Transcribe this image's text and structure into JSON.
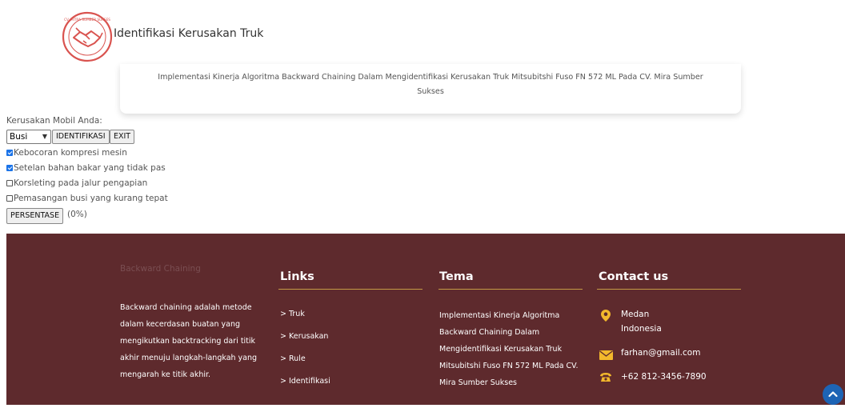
{
  "header": {
    "logo_icon": "handshake-logo-icon",
    "logo_ring_text": "CV. MITRA SUMBER SUKSES",
    "brand_title": "Identifikasi Kerusakan Truk",
    "banner_text": "Implementasi Kinerja Algoritma Backward Chaining Dalam Mengidentifikasi Kerusakan Truk Mitsubitshi Fuso FN 572 ML Pada CV. Mira Sumber Sukses"
  },
  "form": {
    "label": "Kerusakan Mobil Anda:",
    "select_value": "Busi",
    "identify_button": "IDENTIFIKASI",
    "exit_button": "EXIT",
    "options": [
      {
        "label": "Kebocoran kompresi mesin",
        "checked": true
      },
      {
        "label": "Setelan bahan bakar yang tidak pas",
        "checked": true
      },
      {
        "label": "Korsleting pada jalur pengapian",
        "checked": false
      },
      {
        "label": "Pemasangan busi yang kurang tepat",
        "checked": false
      }
    ],
    "percent_button": "PERSENTASE",
    "percent_value": "(0%)"
  },
  "footer": {
    "about_title": "Backward Chaining",
    "about_text": "Backward chaining adalah metode dalam kecerdasan buatan yang mengikutkan backtracking dari titik akhir menuju langkah-langkah yang mengarah ke titik akhir.",
    "links_title": "Links",
    "links": [
      "> Truk",
      "> Kerusakan",
      "> Rule",
      "> Identifikasi"
    ],
    "tema_title": "Tema",
    "tema_text": "Implementasi Kinerja Algoritma Backward Chaining Dalam Mengidentifikasi Kerusakan Truk Mitsubitshi Fuso FN 572 ML Pada CV. Mira Sumber Sukses",
    "contact_title": "Contact us",
    "contact_city": "Medan",
    "contact_country": "Indonesia",
    "contact_email": "farhan@gmail.com",
    "contact_phone": "+62 812-3456-7890"
  },
  "colors": {
    "footer_bg": "#5e2a2d",
    "accent_gold": "#f3b82c",
    "rule_gold": "#c49a45",
    "logo_red": "#d9534f",
    "scroll_button": "#1d64b5"
  }
}
